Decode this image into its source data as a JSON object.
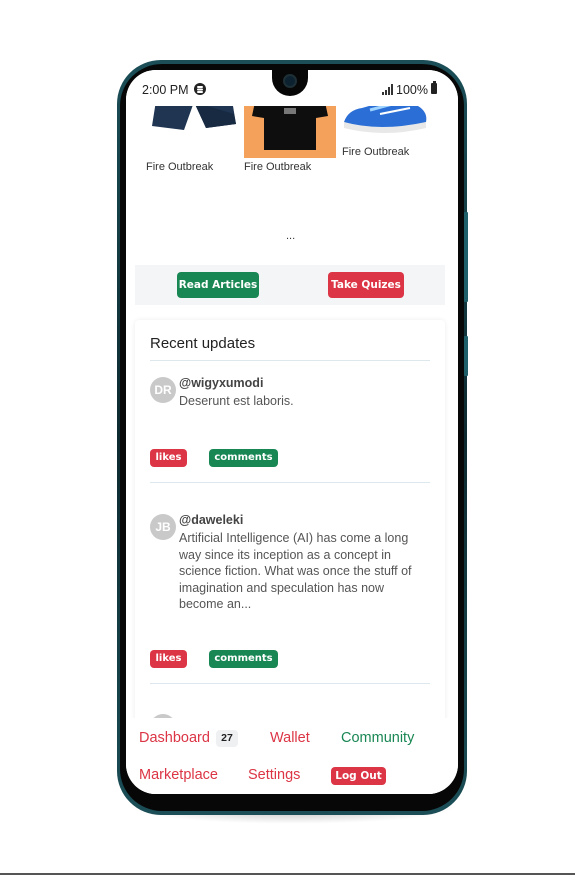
{
  "status_bar": {
    "time": "2:00 PM",
    "battery": "100%",
    "icons": [
      "spotify-icon",
      "signal-icon",
      "battery-icon"
    ]
  },
  "products": [
    {
      "label": "Fire Outbreak",
      "image": "shorts-image"
    },
    {
      "label": "Fire Outbreak",
      "image": "tshirt-image"
    },
    {
      "label": "Fire Outbreak",
      "image": "sneakers-image"
    }
  ],
  "more_indicator": "...",
  "actions": {
    "read_articles": "Read Articles",
    "take_quizzes": "Take Quizes"
  },
  "recent_updates": {
    "title": "Recent updates",
    "posts": [
      {
        "initials": "DR",
        "username": "@wigyxumodi",
        "text": "Deserunt est laboris.",
        "likes_label": "likes",
        "comments_label": "comments"
      },
      {
        "initials": "JB",
        "username": "@daweleki",
        "text": "Artificial Intelligence (AI) has come a long way since its inception as a concept in science fiction. What was once the stuff of imagination and speculation has now become an...",
        "likes_label": "likes",
        "comments_label": "comments"
      }
    ]
  },
  "bottom_nav": {
    "dashboard": "Dashboard",
    "dashboard_badge": "27",
    "wallet": "Wallet",
    "community": "Community",
    "marketplace": "Marketplace",
    "settings": "Settings",
    "logout": "Log Out"
  },
  "colors": {
    "success": "#198754",
    "danger": "#dc3545",
    "frame": "#1b4e57"
  }
}
